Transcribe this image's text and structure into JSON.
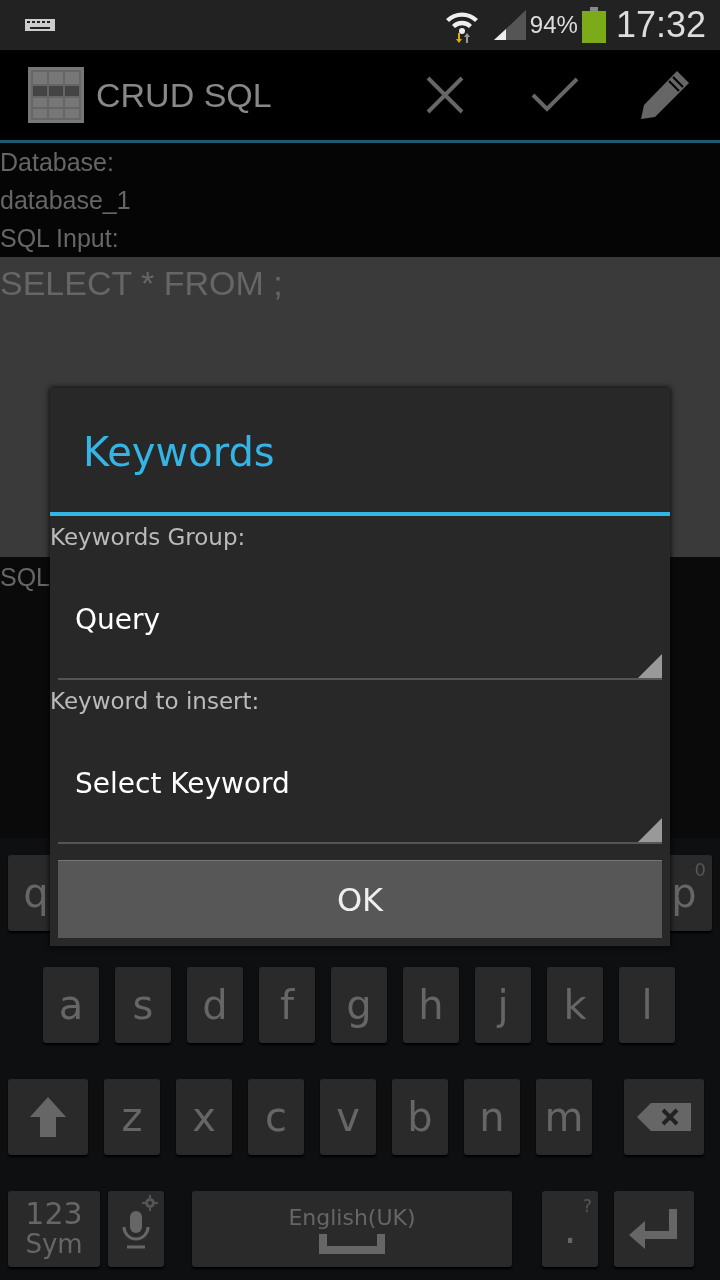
{
  "status_bar": {
    "battery": "94%",
    "time": "17:32"
  },
  "action_bar": {
    "title": "CRUD SQL"
  },
  "form": {
    "database_label": "Database:",
    "database_value": "database_1",
    "sql_input_label": "SQL Input:",
    "sql_input": "SELECT * FROM ;",
    "result_label": "SQL"
  },
  "dialog": {
    "title": "Keywords",
    "fields": [
      {
        "label": "Keywords Group:",
        "value": "Query"
      },
      {
        "label": "Keyword to insert:",
        "value": "Select Keyword"
      }
    ],
    "button": "OK"
  },
  "keyboard": {
    "row_1": [
      {
        "kind": "letter",
        "label": "q"
      },
      {
        "kind": "letter",
        "label": "p",
        "hint": "0"
      }
    ],
    "row_2": [
      {
        "kind": "letter",
        "label": "a"
      },
      {
        "kind": "letter",
        "label": "s"
      },
      {
        "kind": "letter",
        "label": "d"
      },
      {
        "kind": "letter",
        "label": "f"
      },
      {
        "kind": "letter",
        "label": "g"
      },
      {
        "kind": "letter",
        "label": "h"
      },
      {
        "kind": "letter",
        "label": "j"
      },
      {
        "kind": "letter",
        "label": "k"
      },
      {
        "kind": "letter",
        "label": "l"
      }
    ],
    "row_3": [
      {
        "kind": "shift"
      },
      {
        "kind": "letter",
        "label": "z"
      },
      {
        "kind": "letter",
        "label": "x"
      },
      {
        "kind": "letter",
        "label": "c"
      },
      {
        "kind": "letter",
        "label": "v"
      },
      {
        "kind": "letter",
        "label": "b"
      },
      {
        "kind": "letter",
        "label": "n"
      },
      {
        "kind": "letter",
        "label": "m"
      },
      {
        "kind": "backspace"
      }
    ],
    "row_4": [
      {
        "kind": "sym",
        "label": "123",
        "sublabel": "Sym"
      },
      {
        "kind": "mic"
      },
      {
        "kind": "space",
        "label": "English(UK)"
      },
      {
        "kind": "period",
        "label": ".",
        "hint": "?"
      },
      {
        "kind": "enter"
      }
    ]
  }
}
